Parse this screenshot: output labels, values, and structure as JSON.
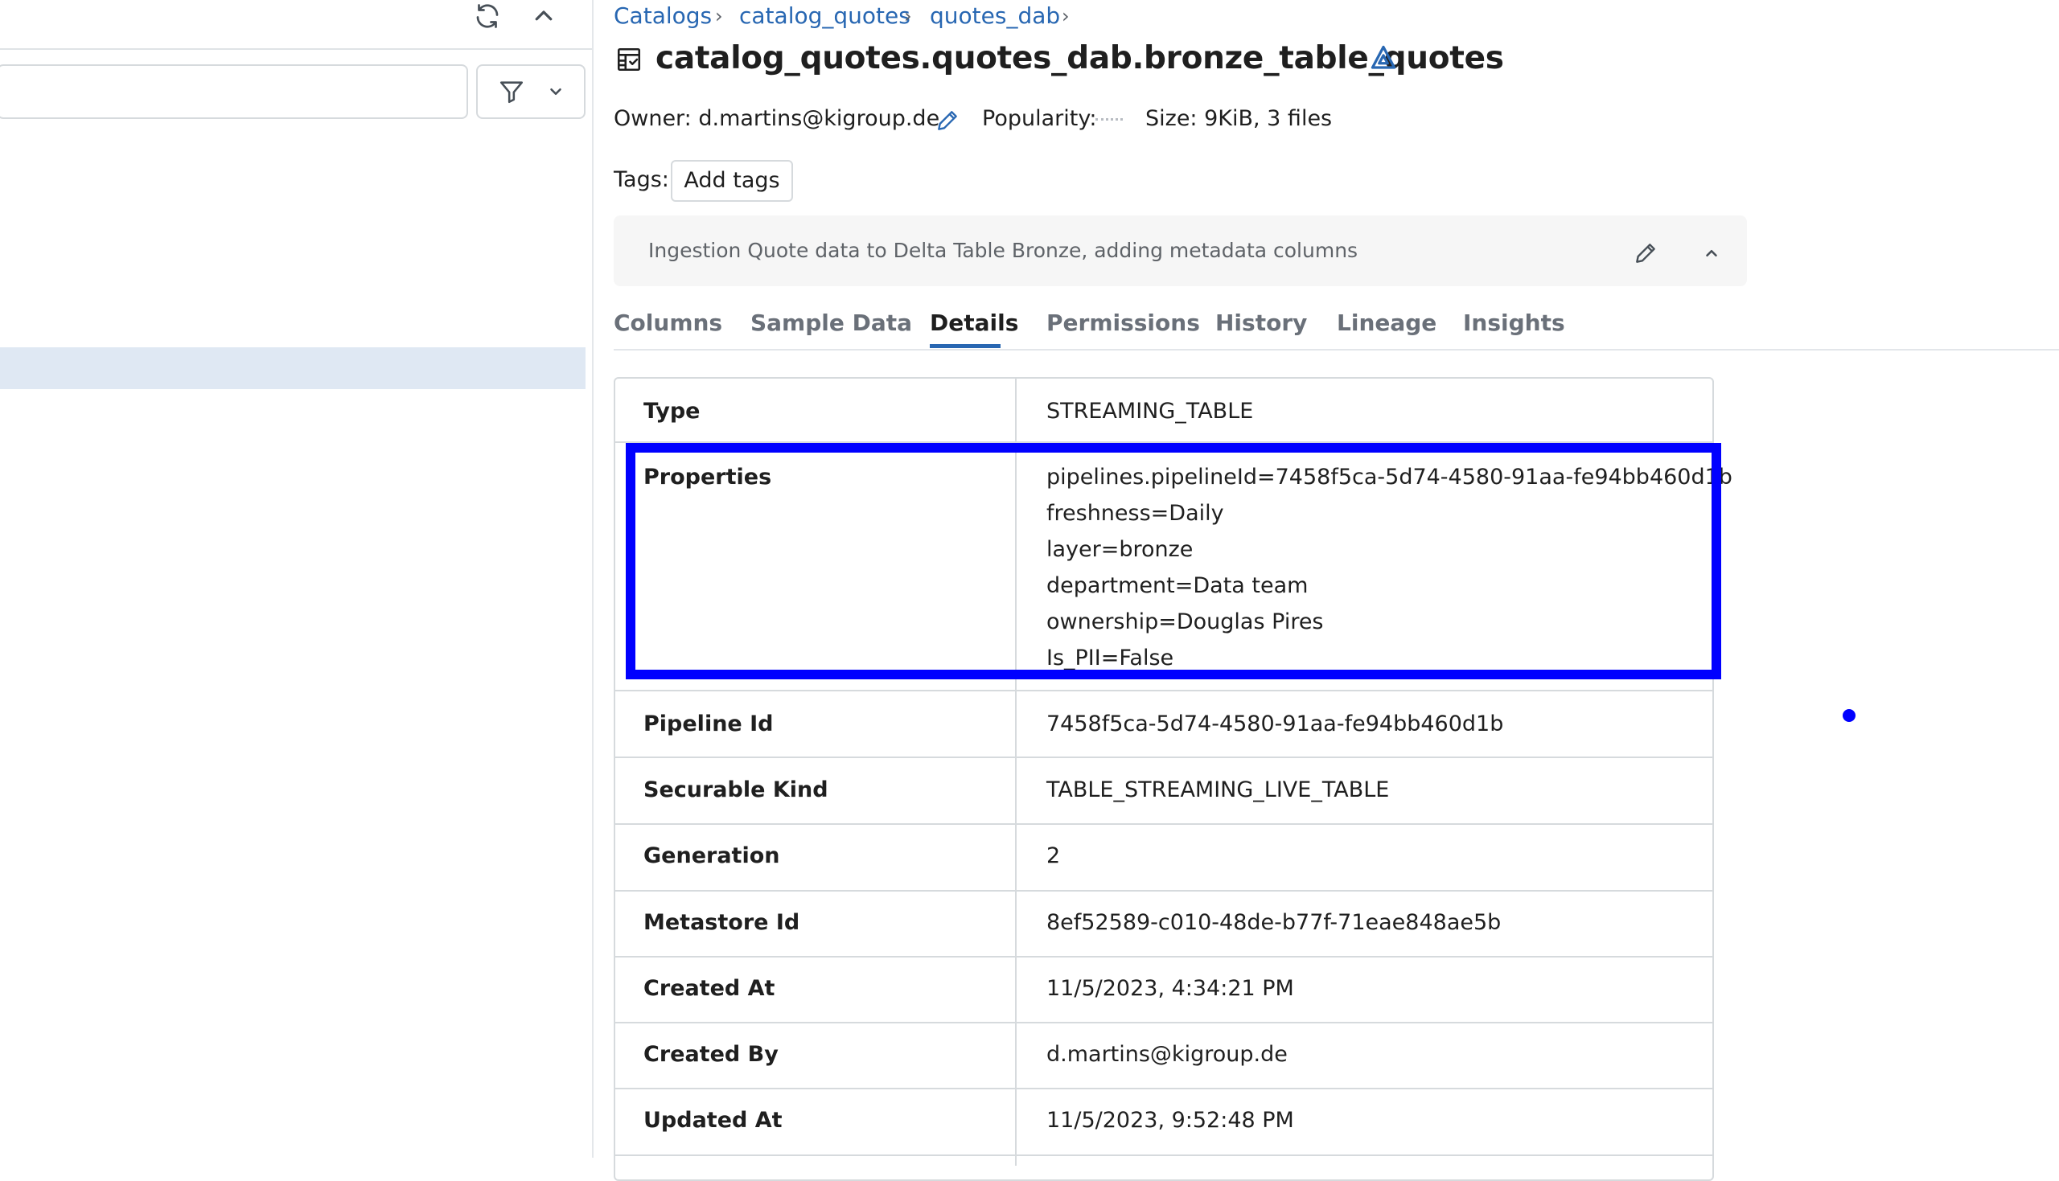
{
  "breadcrumb": {
    "items": [
      "Catalogs",
      "catalog_quotes",
      "quotes_dab"
    ]
  },
  "header": {
    "title": "catalog_quotes.quotes_dab.bronze_table_quotes"
  },
  "meta": {
    "owner": "Owner: d.martins@kigroup.de",
    "popularity_label": "Popularity:",
    "size": "Size: 9KiB, 3 files"
  },
  "tags": {
    "label": "Tags:",
    "add_label": "Add tags"
  },
  "description": "Ingestion Quote data to Delta Table Bronze, adding metadata columns",
  "tabs": [
    {
      "label": "Columns",
      "active": false
    },
    {
      "label": "Sample Data",
      "active": false
    },
    {
      "label": "Details",
      "active": true
    },
    {
      "label": "Permissions",
      "active": false
    },
    {
      "label": "History",
      "active": false
    },
    {
      "label": "Lineage",
      "active": false
    },
    {
      "label": "Insights",
      "active": false
    }
  ],
  "details": {
    "type": {
      "label": "Type",
      "value": "STREAMING_TABLE"
    },
    "properties": {
      "label": "Properties",
      "lines": [
        "pipelines.pipelineId=7458f5ca-5d74-4580-91aa-fe94bb460d1b",
        "freshness=Daily",
        "layer=bronze",
        "department=Data team",
        "ownership=Douglas Pires",
        "Is_PII=False"
      ]
    },
    "pipeline_id": {
      "label": "Pipeline Id",
      "value": "7458f5ca-5d74-4580-91aa-fe94bb460d1b"
    },
    "securable_kind": {
      "label": "Securable Kind",
      "value": "TABLE_STREAMING_LIVE_TABLE"
    },
    "generation": {
      "label": "Generation",
      "value": "2"
    },
    "metastore_id": {
      "label": "Metastore Id",
      "value": "8ef52589-c010-48de-b77f-71eae848ae5b"
    },
    "created_at": {
      "label": "Created At",
      "value": "11/5/2023, 4:34:21 PM"
    },
    "created_by": {
      "label": "Created By",
      "value": "d.martins@kigroup.de"
    },
    "updated_at": {
      "label": "Updated At",
      "value": "11/5/2023, 9:52:48 PM"
    }
  },
  "colors": {
    "link": "#2867b2",
    "highlight": "#0000ff",
    "selected_row": "#dfe8f3"
  },
  "icons": [
    "refresh-icon",
    "collapse-icon",
    "filter-icon",
    "chevron-down-icon",
    "table-icon",
    "delta-icon",
    "edit-icon"
  ]
}
